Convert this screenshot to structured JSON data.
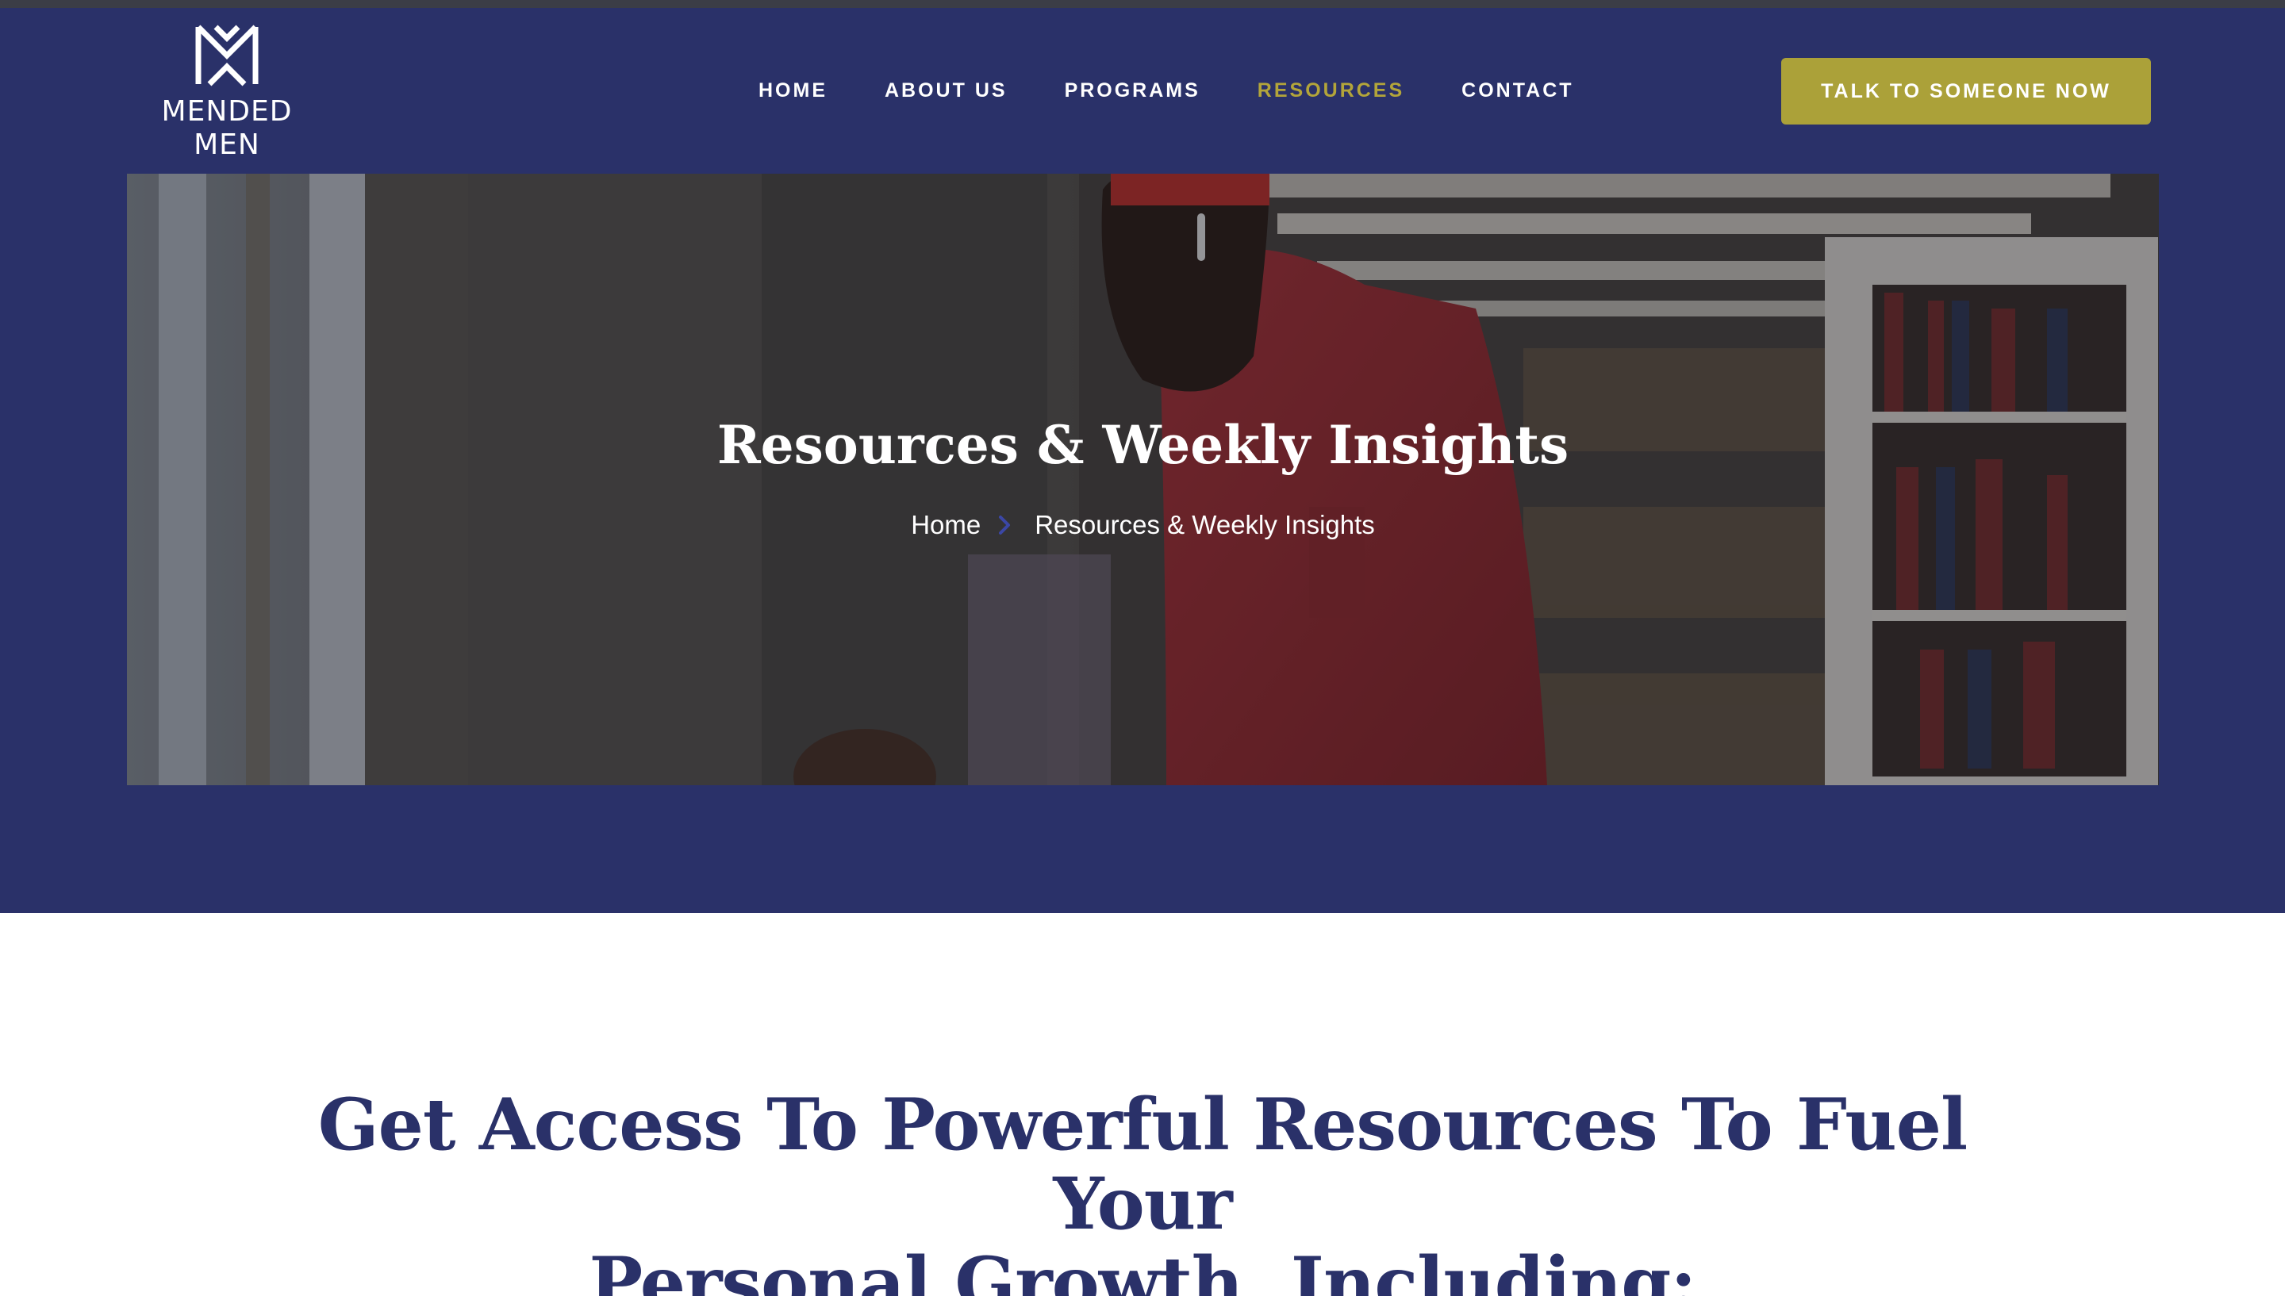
{
  "brand": {
    "logo_line1": "MENDED",
    "logo_line2": "MEN",
    "logo_icon": "mm-monogram-icon"
  },
  "nav": {
    "items": [
      {
        "label": "HOME",
        "active": false
      },
      {
        "label": "ABOUT US",
        "active": false
      },
      {
        "label": "PROGRAMS",
        "active": false
      },
      {
        "label": "RESOURCES",
        "active": true
      },
      {
        "label": "CONTACT",
        "active": false
      }
    ],
    "cta_label": "TALK TO SOMEONE NOW"
  },
  "hero": {
    "title": "Resources & Weekly Insights",
    "breadcrumb": {
      "home": "Home",
      "separator_icon": "chevron-right-icon",
      "current": "Resources & Weekly Insights"
    }
  },
  "main": {
    "heading_line1": "Get Access To Powerful Resources To Fuel Your",
    "heading_line2": "Personal Growth, Including:"
  },
  "colors": {
    "navy": "#2a3169",
    "accent_olive": "#aba139",
    "active_nav": "#b3a53a",
    "white": "#ffffff"
  }
}
